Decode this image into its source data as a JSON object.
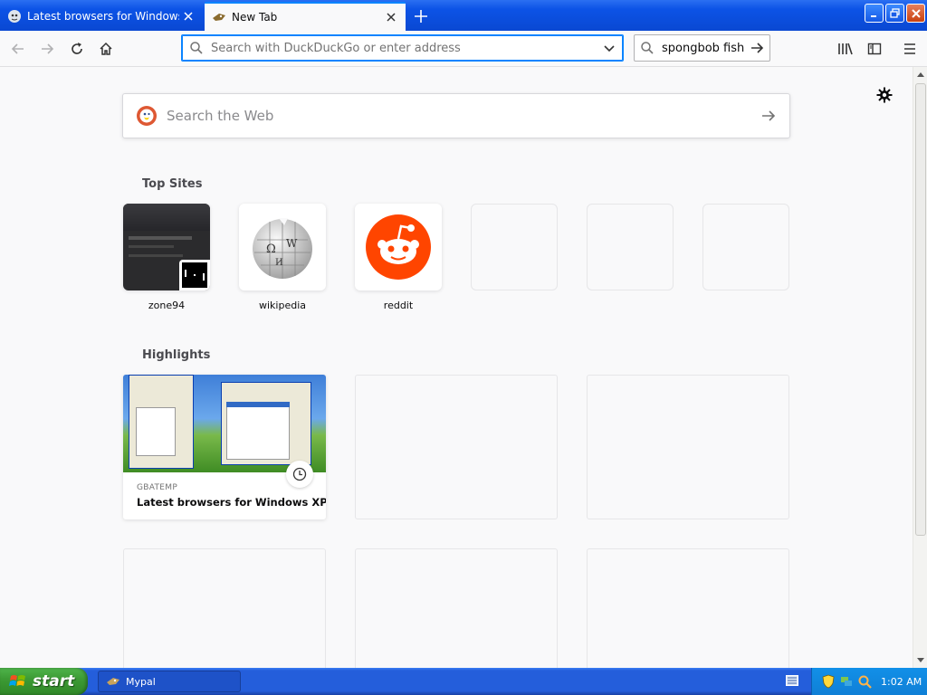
{
  "tabs": [
    {
      "label": "Latest browsers for Windows XP, ",
      "active": false
    },
    {
      "label": "New Tab",
      "active": true
    }
  ],
  "navbar": {
    "url_placeholder": "Search with DuckDuckGo or enter address",
    "search_value": "spongbob fish"
  },
  "content": {
    "web_search_placeholder": "Search the Web",
    "top_sites_title": "Top Sites",
    "top_sites": [
      {
        "label": "zone94",
        "icon": "zone94-thumbnail"
      },
      {
        "label": "wikipedia",
        "icon": "wikipedia-globe-icon"
      },
      {
        "label": "reddit",
        "icon": "reddit-alien-icon"
      },
      {
        "label": ""
      },
      {
        "label": ""
      },
      {
        "label": ""
      }
    ],
    "highlights_title": "Highlights",
    "highlights": [
      {
        "source": "GBATEMP",
        "title": "Latest browsers for Windows XP..."
      }
    ]
  },
  "taskbar": {
    "start_label": "start",
    "task_label": "Mypal",
    "clock": "1:02 AM"
  },
  "colors": {
    "accent": "#0a84ff",
    "reddit": "#ff4500",
    "xp_blue": "#245edb",
    "xp_green": "#3d9b35"
  }
}
